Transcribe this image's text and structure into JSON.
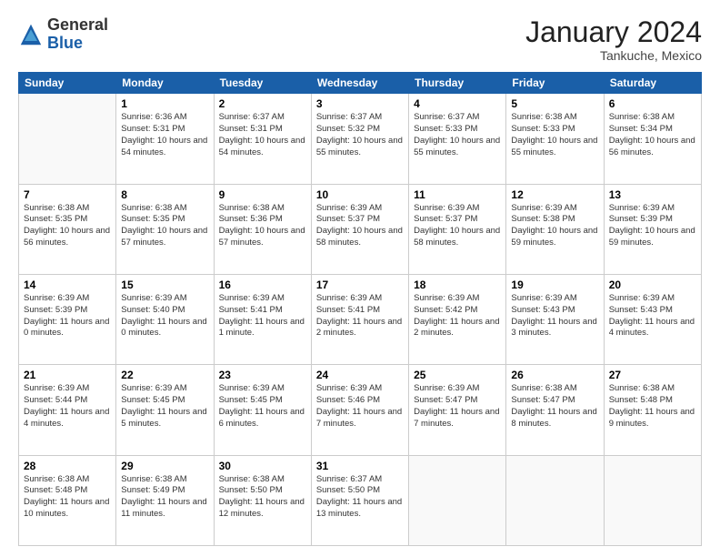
{
  "header": {
    "logo_general": "General",
    "logo_blue": "Blue",
    "month_title": "January 2024",
    "subtitle": "Tankuche, Mexico"
  },
  "columns": [
    "Sunday",
    "Monday",
    "Tuesday",
    "Wednesday",
    "Thursday",
    "Friday",
    "Saturday"
  ],
  "weeks": [
    [
      {
        "day": "",
        "info": ""
      },
      {
        "day": "1",
        "info": "Sunrise: 6:36 AM\nSunset: 5:31 PM\nDaylight: 10 hours\nand 54 minutes."
      },
      {
        "day": "2",
        "info": "Sunrise: 6:37 AM\nSunset: 5:31 PM\nDaylight: 10 hours\nand 54 minutes."
      },
      {
        "day": "3",
        "info": "Sunrise: 6:37 AM\nSunset: 5:32 PM\nDaylight: 10 hours\nand 55 minutes."
      },
      {
        "day": "4",
        "info": "Sunrise: 6:37 AM\nSunset: 5:33 PM\nDaylight: 10 hours\nand 55 minutes."
      },
      {
        "day": "5",
        "info": "Sunrise: 6:38 AM\nSunset: 5:33 PM\nDaylight: 10 hours\nand 55 minutes."
      },
      {
        "day": "6",
        "info": "Sunrise: 6:38 AM\nSunset: 5:34 PM\nDaylight: 10 hours\nand 56 minutes."
      }
    ],
    [
      {
        "day": "7",
        "info": "Sunrise: 6:38 AM\nSunset: 5:35 PM\nDaylight: 10 hours\nand 56 minutes."
      },
      {
        "day": "8",
        "info": "Sunrise: 6:38 AM\nSunset: 5:35 PM\nDaylight: 10 hours\nand 57 minutes."
      },
      {
        "day": "9",
        "info": "Sunrise: 6:38 AM\nSunset: 5:36 PM\nDaylight: 10 hours\nand 57 minutes."
      },
      {
        "day": "10",
        "info": "Sunrise: 6:39 AM\nSunset: 5:37 PM\nDaylight: 10 hours\nand 58 minutes."
      },
      {
        "day": "11",
        "info": "Sunrise: 6:39 AM\nSunset: 5:37 PM\nDaylight: 10 hours\nand 58 minutes."
      },
      {
        "day": "12",
        "info": "Sunrise: 6:39 AM\nSunset: 5:38 PM\nDaylight: 10 hours\nand 59 minutes."
      },
      {
        "day": "13",
        "info": "Sunrise: 6:39 AM\nSunset: 5:39 PM\nDaylight: 10 hours\nand 59 minutes."
      }
    ],
    [
      {
        "day": "14",
        "info": "Sunrise: 6:39 AM\nSunset: 5:39 PM\nDaylight: 11 hours\nand 0 minutes."
      },
      {
        "day": "15",
        "info": "Sunrise: 6:39 AM\nSunset: 5:40 PM\nDaylight: 11 hours\nand 0 minutes."
      },
      {
        "day": "16",
        "info": "Sunrise: 6:39 AM\nSunset: 5:41 PM\nDaylight: 11 hours\nand 1 minute."
      },
      {
        "day": "17",
        "info": "Sunrise: 6:39 AM\nSunset: 5:41 PM\nDaylight: 11 hours\nand 2 minutes."
      },
      {
        "day": "18",
        "info": "Sunrise: 6:39 AM\nSunset: 5:42 PM\nDaylight: 11 hours\nand 2 minutes."
      },
      {
        "day": "19",
        "info": "Sunrise: 6:39 AM\nSunset: 5:43 PM\nDaylight: 11 hours\nand 3 minutes."
      },
      {
        "day": "20",
        "info": "Sunrise: 6:39 AM\nSunset: 5:43 PM\nDaylight: 11 hours\nand 4 minutes."
      }
    ],
    [
      {
        "day": "21",
        "info": "Sunrise: 6:39 AM\nSunset: 5:44 PM\nDaylight: 11 hours\nand 4 minutes."
      },
      {
        "day": "22",
        "info": "Sunrise: 6:39 AM\nSunset: 5:45 PM\nDaylight: 11 hours\nand 5 minutes."
      },
      {
        "day": "23",
        "info": "Sunrise: 6:39 AM\nSunset: 5:45 PM\nDaylight: 11 hours\nand 6 minutes."
      },
      {
        "day": "24",
        "info": "Sunrise: 6:39 AM\nSunset: 5:46 PM\nDaylight: 11 hours\nand 7 minutes."
      },
      {
        "day": "25",
        "info": "Sunrise: 6:39 AM\nSunset: 5:47 PM\nDaylight: 11 hours\nand 7 minutes."
      },
      {
        "day": "26",
        "info": "Sunrise: 6:38 AM\nSunset: 5:47 PM\nDaylight: 11 hours\nand 8 minutes."
      },
      {
        "day": "27",
        "info": "Sunrise: 6:38 AM\nSunset: 5:48 PM\nDaylight: 11 hours\nand 9 minutes."
      }
    ],
    [
      {
        "day": "28",
        "info": "Sunrise: 6:38 AM\nSunset: 5:48 PM\nDaylight: 11 hours\nand 10 minutes."
      },
      {
        "day": "29",
        "info": "Sunrise: 6:38 AM\nSunset: 5:49 PM\nDaylight: 11 hours\nand 11 minutes."
      },
      {
        "day": "30",
        "info": "Sunrise: 6:38 AM\nSunset: 5:50 PM\nDaylight: 11 hours\nand 12 minutes."
      },
      {
        "day": "31",
        "info": "Sunrise: 6:37 AM\nSunset: 5:50 PM\nDaylight: 11 hours\nand 13 minutes."
      },
      {
        "day": "",
        "info": ""
      },
      {
        "day": "",
        "info": ""
      },
      {
        "day": "",
        "info": ""
      }
    ]
  ]
}
